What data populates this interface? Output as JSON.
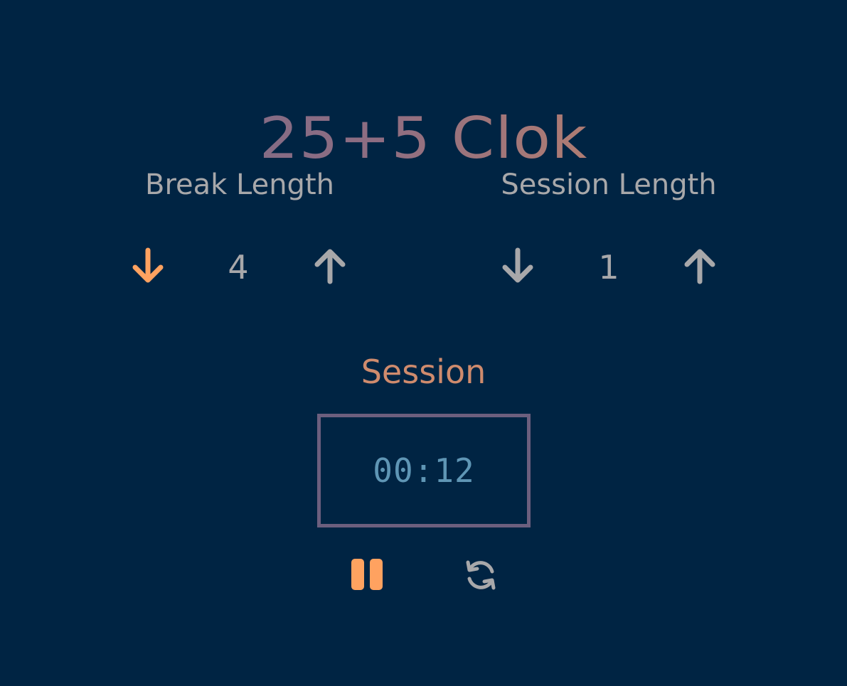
{
  "app": {
    "title": "25+5 Clok"
  },
  "break": {
    "label": "Break Length",
    "value": "4",
    "decrement_icon": "arrow-down-icon",
    "increment_icon": "arrow-up-icon"
  },
  "session": {
    "label": "Session Length",
    "value": "1",
    "decrement_icon": "arrow-down-icon",
    "increment_icon": "arrow-up-icon"
  },
  "timer": {
    "label": "Session",
    "time_left": "00:12",
    "start_stop_icon": "pause-icon",
    "reset_icon": "refresh-icon"
  },
  "colors": {
    "background": "#002443",
    "accent": "#ffa260",
    "muted": "#a8a8aa",
    "timer_text": "#5f96b5",
    "timer_border": "#6c5f7e",
    "timer_label": "#cf8b6d"
  }
}
